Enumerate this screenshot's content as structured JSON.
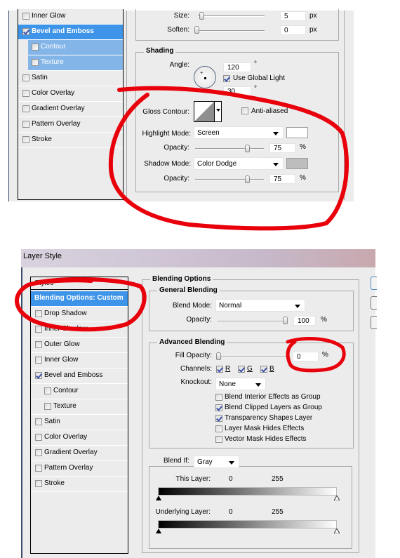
{
  "top_panel": {
    "style_list": {
      "items": [
        {
          "label": "Inner Glow",
          "checked": false,
          "state": "normal"
        },
        {
          "label": "Bevel and Emboss",
          "checked": true,
          "state": "selected"
        },
        {
          "label": "Contour",
          "checked": false,
          "state": "sub-selected"
        },
        {
          "label": "Texture",
          "checked": false,
          "state": "sub-selected"
        },
        {
          "label": "Satin",
          "checked": false,
          "state": "normal"
        },
        {
          "label": "Color Overlay",
          "checked": false,
          "state": "normal"
        },
        {
          "label": "Gradient Overlay",
          "checked": false,
          "state": "normal"
        },
        {
          "label": "Pattern Overlay",
          "checked": false,
          "state": "normal"
        },
        {
          "label": "Stroke",
          "checked": false,
          "state": "normal"
        }
      ]
    },
    "structure": {
      "size_label": "Size:",
      "size_value": "5",
      "size_unit": "px",
      "soften_label": "Soften:",
      "soften_value": "0",
      "soften_unit": "px"
    },
    "shading": {
      "title": "Shading",
      "angle_label": "Angle:",
      "angle_value": "120",
      "degree": "°",
      "use_global_light": "Use Global Light",
      "use_global_light_checked": true,
      "altitude_value": "30",
      "gloss_contour_label": "Gloss Contour:",
      "anti_aliased_label": "Anti-aliased",
      "highlight_mode_label": "Highlight Mode:",
      "highlight_mode_value": "Screen",
      "highlight_color": "#ffffff",
      "highlight_opacity_label": "Opacity:",
      "highlight_opacity_value": "75",
      "shadow_mode_label": "Shadow Mode:",
      "shadow_mode_value": "Color Dodge",
      "shadow_color": "#bdbdbd",
      "shadow_opacity_label": "Opacity:",
      "shadow_opacity_value": "75",
      "percent": "%"
    }
  },
  "bottom_panel": {
    "window_title": "Layer Style",
    "style_list": {
      "header": "Styles",
      "items": [
        {
          "label": "Blending Options: Custom",
          "state": "selected",
          "has_checkbox": false
        },
        {
          "label": "Drop Shadow",
          "checked": false,
          "state": "normal",
          "has_checkbox": true
        },
        {
          "label": "Inner Shadow",
          "checked": false,
          "state": "normal",
          "has_checkbox": true
        },
        {
          "label": "Outer Glow",
          "checked": false,
          "state": "normal",
          "has_checkbox": true
        },
        {
          "label": "Inner Glow",
          "checked": false,
          "state": "normal",
          "has_checkbox": true
        },
        {
          "label": "Bevel and Emboss",
          "checked": true,
          "state": "normal",
          "has_checkbox": true
        },
        {
          "label": "Contour",
          "checked": false,
          "state": "normal",
          "has_checkbox": true,
          "indent": true
        },
        {
          "label": "Texture",
          "checked": false,
          "state": "normal",
          "has_checkbox": true,
          "indent": true
        },
        {
          "label": "Satin",
          "checked": false,
          "state": "normal",
          "has_checkbox": true
        },
        {
          "label": "Color Overlay",
          "checked": false,
          "state": "normal",
          "has_checkbox": true
        },
        {
          "label": "Gradient Overlay",
          "checked": false,
          "state": "normal",
          "has_checkbox": true
        },
        {
          "label": "Pattern Overlay",
          "checked": false,
          "state": "normal",
          "has_checkbox": true
        },
        {
          "label": "Stroke",
          "checked": false,
          "state": "normal",
          "has_checkbox": true
        }
      ]
    },
    "blending_options": {
      "title": "Blending Options",
      "general": {
        "title": "General Blending",
        "blend_mode_label": "Blend Mode:",
        "blend_mode_value": "Normal",
        "opacity_label": "Opacity:",
        "opacity_value": "100",
        "percent": "%"
      },
      "advanced": {
        "title": "Advanced Blending",
        "fill_opacity_label": "Fill Opacity:",
        "fill_opacity_value": "0",
        "percent": "%",
        "channels_label": "Channels:",
        "channels": [
          {
            "label": "R",
            "checked": true
          },
          {
            "label": "G",
            "checked": true
          },
          {
            "label": "B",
            "checked": true
          }
        ],
        "knockout_label": "Knockout:",
        "knockout_value": "None",
        "options": [
          {
            "label": "Blend Interior Effects as Group",
            "checked": false
          },
          {
            "label": "Blend Clipped Layers as Group",
            "checked": true
          },
          {
            "label": "Transparency Shapes Layer",
            "checked": true
          },
          {
            "label": "Layer Mask Hides Effects",
            "checked": false
          },
          {
            "label": "Vector Mask Hides Effects",
            "checked": false
          }
        ]
      },
      "blend_if": {
        "label": "Blend If:",
        "value": "Gray",
        "this_layer_label": "This Layer:",
        "this_layer_min": "0",
        "this_layer_max": "255",
        "underlying_label": "Underlying Layer:",
        "underlying_min": "0",
        "underlying_max": "255"
      }
    }
  },
  "annotations": {
    "color": "#e8000b"
  }
}
